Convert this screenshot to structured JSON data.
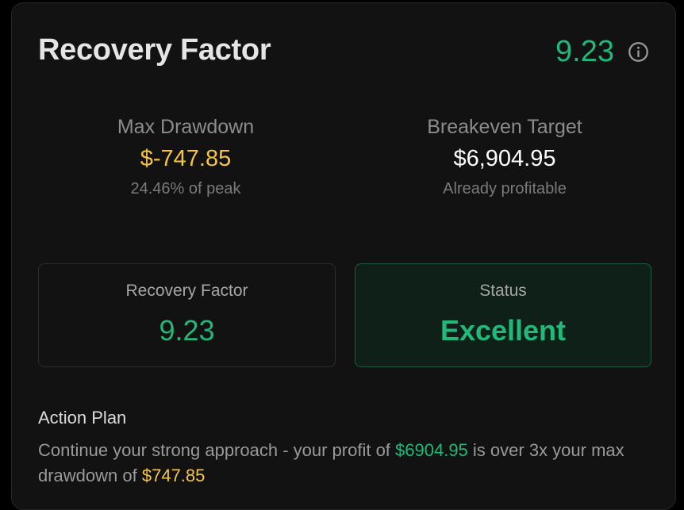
{
  "header": {
    "title": "Recovery Factor",
    "value": "9.23",
    "info_icon": "info-circle-icon"
  },
  "metrics": {
    "max_drawdown": {
      "label": "Max Drawdown",
      "value": "$-747.85",
      "sub": "24.46% of peak"
    },
    "breakeven": {
      "label": "Breakeven Target",
      "value": "$6,904.95",
      "sub": "Already profitable"
    }
  },
  "boxes": {
    "recovery": {
      "label": "Recovery Factor",
      "value": "9.23"
    },
    "status": {
      "label": "Status",
      "value": "Excellent"
    }
  },
  "action_plan": {
    "title": "Action Plan",
    "text_part1": "Continue your strong approach - your profit of ",
    "profit": "$6904.95",
    "text_part2": " is over 3x your max drawdown of ",
    "drawdown": "$747.85"
  },
  "colors": {
    "accent_green": "#22b879",
    "accent_yellow": "#f5c542",
    "background": "#121212"
  }
}
